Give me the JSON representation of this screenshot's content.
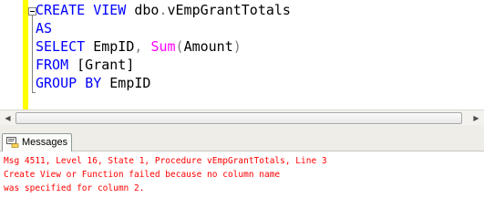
{
  "editor": {
    "lines": [
      {
        "segments": [
          {
            "text": "CREATE",
            "cls": "kw"
          },
          {
            "text": " ",
            "cls": ""
          },
          {
            "text": "VIEW",
            "cls": "kw"
          },
          {
            "text": " dbo",
            "cls": ""
          },
          {
            "text": ".",
            "cls": "op"
          },
          {
            "text": "vEmpGrantTotals",
            "cls": ""
          }
        ]
      },
      {
        "segments": [
          {
            "text": "AS",
            "cls": "kw"
          }
        ]
      },
      {
        "segments": [
          {
            "text": "SELECT",
            "cls": "kw"
          },
          {
            "text": " EmpID",
            "cls": ""
          },
          {
            "text": ",",
            "cls": "op"
          },
          {
            "text": " ",
            "cls": ""
          },
          {
            "text": "Sum",
            "cls": "fn"
          },
          {
            "text": "(",
            "cls": "op"
          },
          {
            "text": "Amount",
            "cls": ""
          },
          {
            "text": ")",
            "cls": "op"
          }
        ]
      },
      {
        "segments": [
          {
            "text": "FROM",
            "cls": "kw"
          },
          {
            "text": " ",
            "cls": ""
          },
          {
            "text": "[Grant]",
            "cls": ""
          }
        ]
      },
      {
        "segments": [
          {
            "text": "GROUP",
            "cls": "kw"
          },
          {
            "text": " ",
            "cls": ""
          },
          {
            "text": "BY",
            "cls": "kw"
          },
          {
            "text": " EmpID",
            "cls": ""
          }
        ]
      }
    ]
  },
  "scrollbar": {
    "left_arrow": "◀",
    "right_arrow": "▶"
  },
  "tabs": {
    "messages_label": "Messages",
    "messages_icon": "messages-icon"
  },
  "messages": {
    "lines": [
      "Msg 4511, Level 16, State 1, Procedure vEmpGrantTotals, Line 3",
      "Create View or Function failed because no column name",
      "was specified for column 2."
    ]
  },
  "colors": {
    "keyword": "#0000ff",
    "function": "#ff00ff",
    "operator": "#808080",
    "error_text": "#ff0000",
    "gutter_marker": "#ffff00"
  }
}
